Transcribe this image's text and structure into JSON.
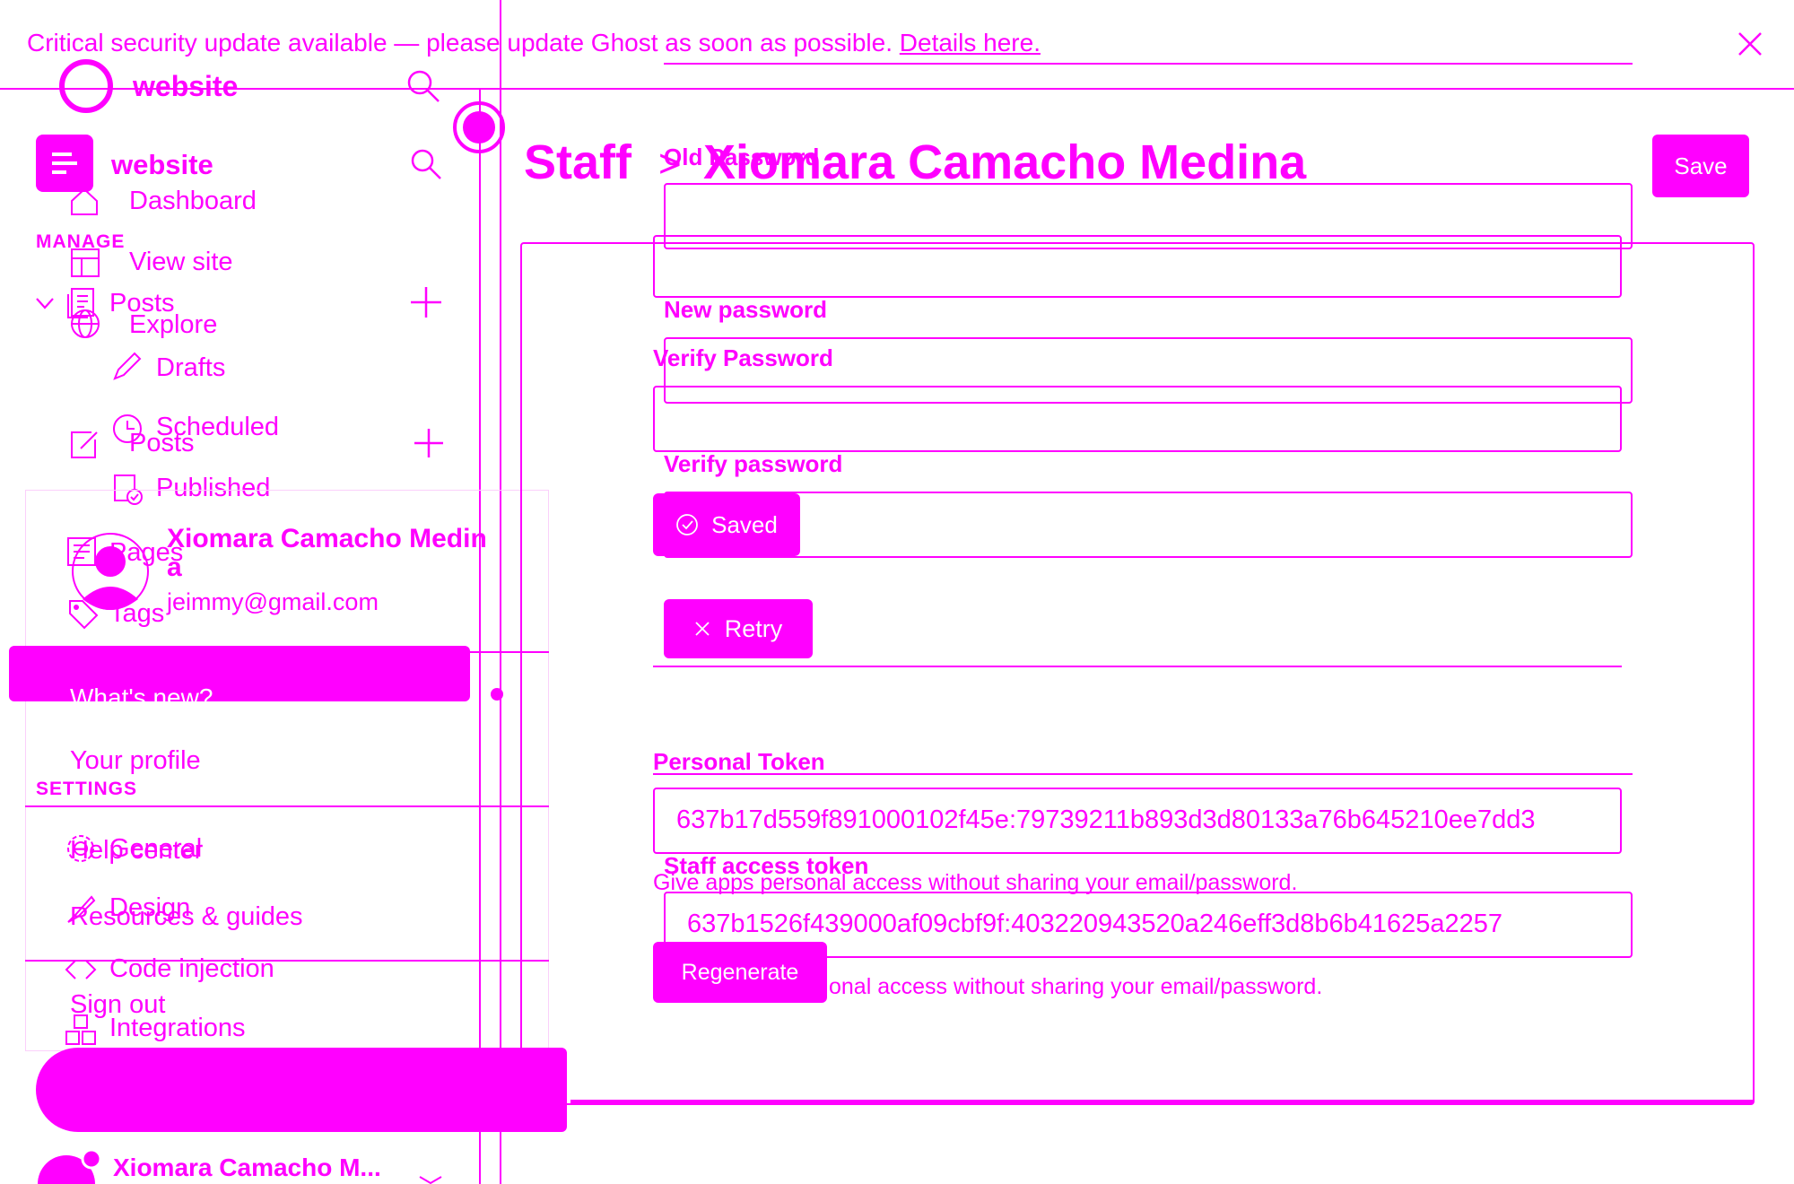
{
  "banner": {
    "text": "Critical security update available — please update Ghost as soon as possible.",
    "link": "Details here."
  },
  "sidebar": {
    "site_name": "website",
    "site_name_2": "website",
    "section_manage": "MANAGE",
    "section_settings": "SETTINGS",
    "items": {
      "dashboard": "Dashboard",
      "view_site": "View site",
      "posts": "Posts",
      "explore": "Explore",
      "drafts": "Drafts",
      "posts2": "Posts",
      "scheduled": "Scheduled",
      "published": "Published",
      "pages": "Pages",
      "tags": "Tags",
      "general": "General",
      "design": "Design",
      "code_injection": "Code injection",
      "integrations": "Integrations"
    },
    "footer_user": "Xiomara Camacho M..."
  },
  "user_menu": {
    "name": "Xiomara Camacho Medin",
    "name_wrap": "a",
    "email": "jeimmy@gmail.com",
    "whats_new": "What's new?",
    "your_profile": "Your profile",
    "help_center": "Help center",
    "resources": "Resources & guides",
    "sign_out": "Sign out"
  },
  "header": {
    "breadcrumb_root": "Staff",
    "breadcrumb_sep": ">",
    "title": "Xiomara Camacho Medina",
    "save_label": "Save"
  },
  "form": {
    "old_password_label": "Old Password",
    "new_password_label": "New password",
    "verify_password_label": "Verify Password",
    "verify_password_label2": "Verify password",
    "saved_label": "Saved",
    "retry_label": "Retry",
    "personal_token_label": "Personal Token",
    "personal_token_value": "637b17d559f891000102f45e:79739211b893d3d80133a76b645210ee7dd3",
    "staff_token_label": "Staff access token",
    "token_help": "Give apps personal access without sharing your email/password.",
    "staff_token_value": "637b1526f439000af09cbf9f:403220943520a246eff3d8b6b41625a2257",
    "token_help_2": "onal access without sharing your email/password.",
    "regenerate_label": "Regenerate"
  },
  "colors": {
    "accent": "#ff00ff",
    "background": "#ffffff"
  }
}
